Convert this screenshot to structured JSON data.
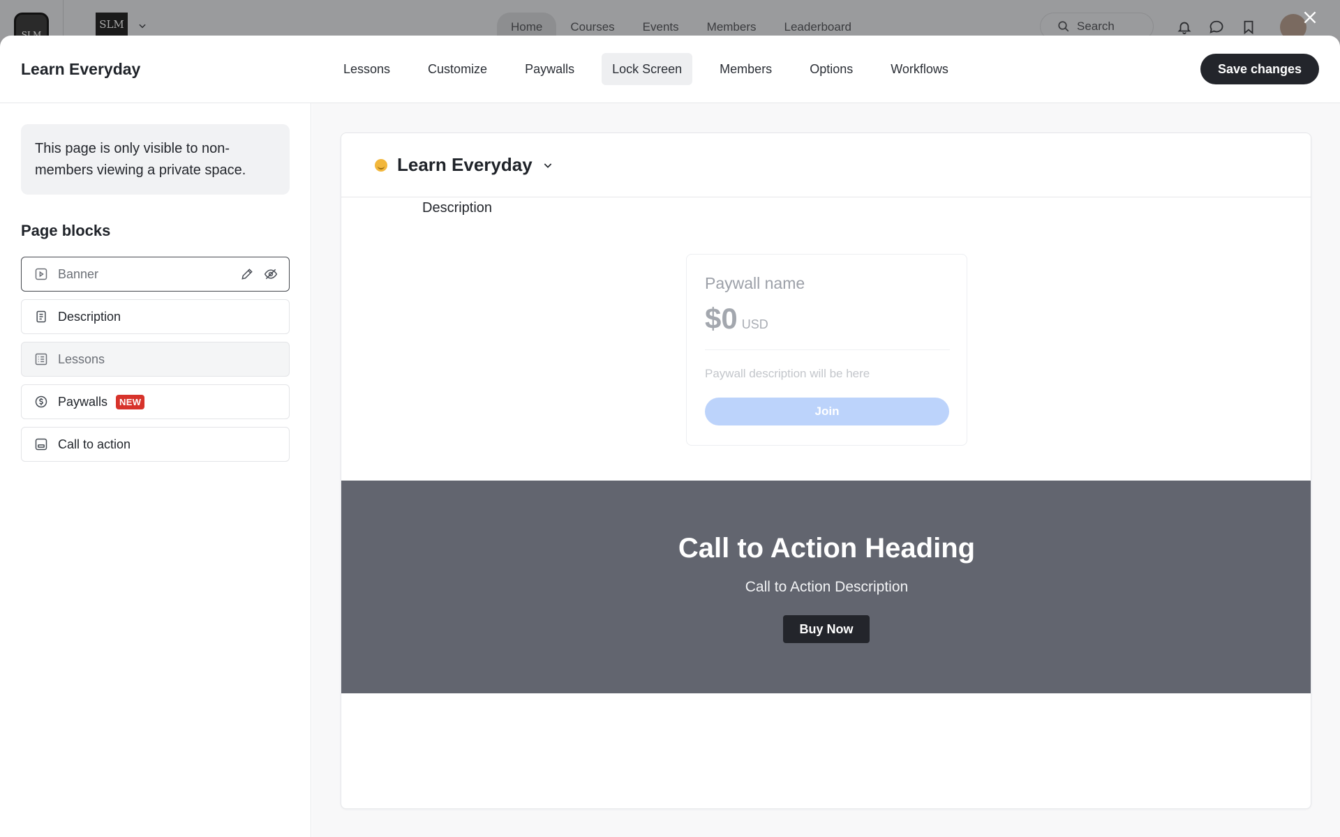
{
  "background_app": {
    "logo_text": "SLM",
    "brand_text": "SLM",
    "nav": [
      "Home",
      "Courses",
      "Events",
      "Members",
      "Leaderboard"
    ],
    "active_nav": "Home",
    "search_placeholder": "Search"
  },
  "modal": {
    "title": "Learn Everyday",
    "tabs": [
      {
        "label": "Lessons"
      },
      {
        "label": "Customize"
      },
      {
        "label": "Paywalls"
      },
      {
        "label": "Lock Screen",
        "active": true
      },
      {
        "label": "Members"
      },
      {
        "label": "Options"
      },
      {
        "label": "Workflows"
      }
    ],
    "save_label": "Save changes"
  },
  "sidebar": {
    "notice": "This page is only visible to non-members viewing a private space.",
    "blocks_title": "Page blocks",
    "blocks": [
      {
        "label": "Banner",
        "icon": "play-square-icon",
        "state": "selected-hidden"
      },
      {
        "label": "Description",
        "icon": "document-icon",
        "state": "enabled"
      },
      {
        "label": "Lessons",
        "icon": "list-icon",
        "state": "disabled"
      },
      {
        "label": "Paywalls",
        "icon": "dollar-circle-icon",
        "state": "enabled",
        "badge": "NEW"
      },
      {
        "label": "Call to action",
        "icon": "cta-icon",
        "state": "enabled"
      }
    ]
  },
  "preview": {
    "space_name": "Learn Everyday",
    "description_label": "Description",
    "paywall": {
      "name": "Paywall name",
      "amount": "$0",
      "currency": "USD",
      "description": "Paywall description will be here",
      "join_label": "Join"
    },
    "cta": {
      "heading": "Call to Action Heading",
      "description": "Call to Action Description",
      "button_label": "Buy Now"
    }
  },
  "colors": {
    "primary_dark": "#23252b",
    "cta_background": "#62656f",
    "join_button": "#bcd3fb",
    "badge_new": "#d7332b"
  }
}
